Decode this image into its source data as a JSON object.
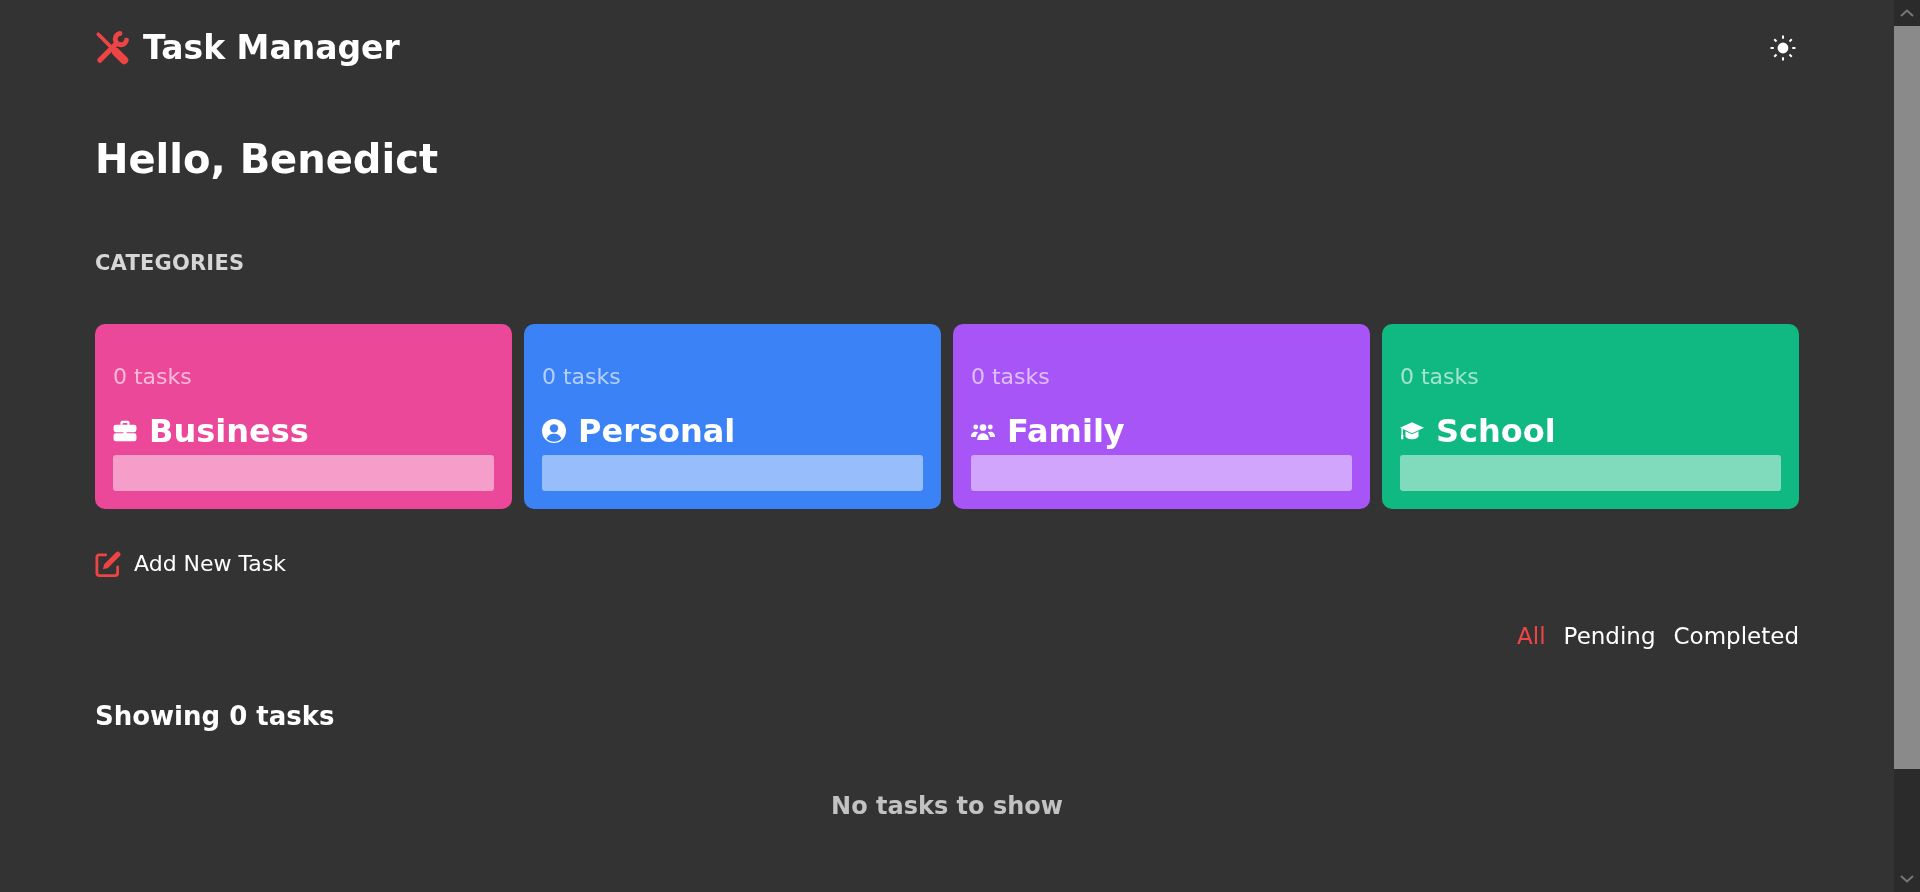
{
  "header": {
    "title": "Task Manager"
  },
  "greeting": "Hello, Benedict",
  "categories": {
    "heading": "CATEGORIES",
    "items": [
      {
        "kind": "business",
        "tasks_count": "0 tasks",
        "name": "Business",
        "color": "#ec4899"
      },
      {
        "kind": "personal",
        "tasks_count": "0 tasks",
        "name": "Personal",
        "color": "#3b82f6"
      },
      {
        "kind": "family",
        "tasks_count": "0 tasks",
        "name": "Family",
        "color": "#a855f7"
      },
      {
        "kind": "school",
        "tasks_count": "0 tasks",
        "name": "School",
        "color": "#10b981"
      }
    ]
  },
  "add_task": {
    "label": "Add New Task"
  },
  "filters": [
    {
      "label": "All",
      "selected": true
    },
    {
      "label": "Pending",
      "selected": false
    },
    {
      "label": "Completed",
      "selected": false
    }
  ],
  "task_list": {
    "heading": "Showing 0 tasks",
    "empty_message": "No tasks to show"
  }
}
